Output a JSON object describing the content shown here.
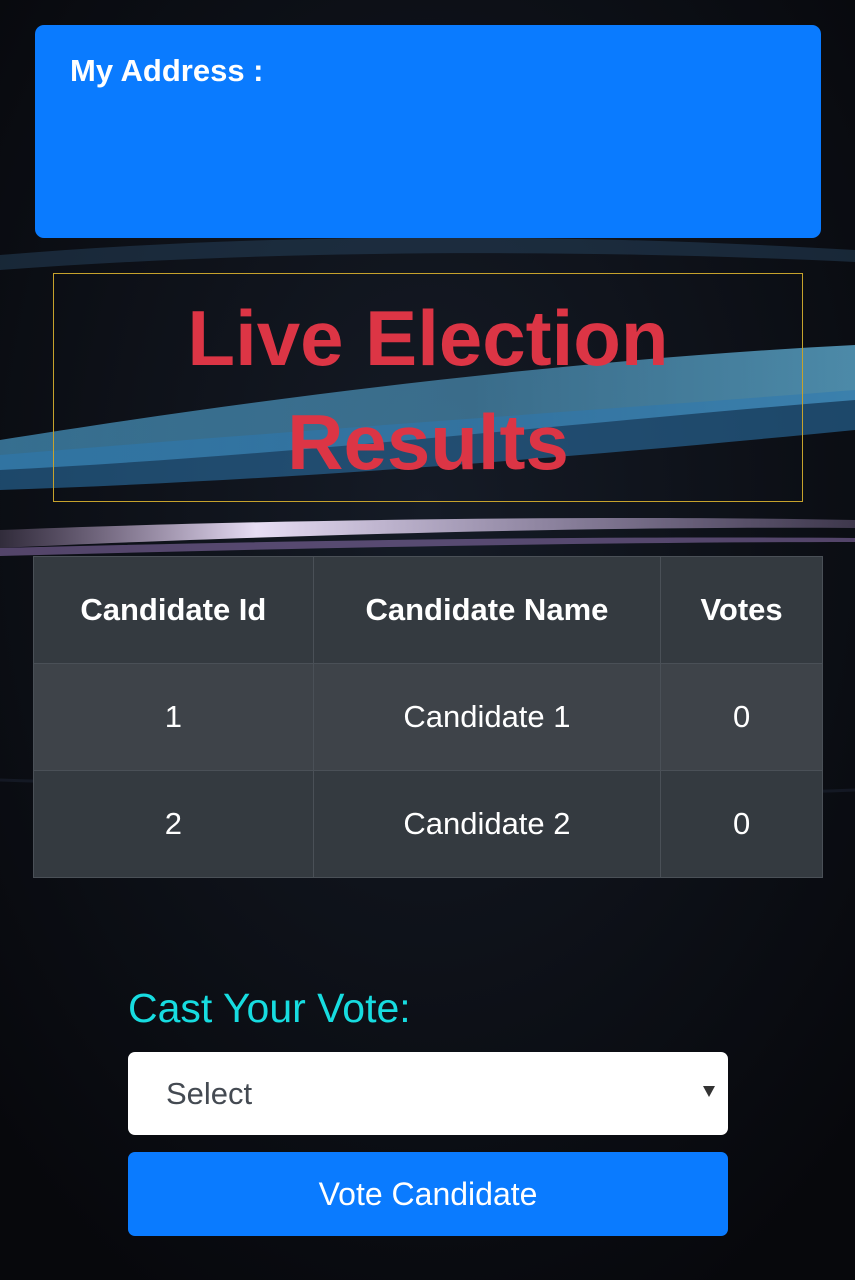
{
  "colors": {
    "accent": "#0a7bff",
    "title": "#dc3545",
    "heading": "#17dce0",
    "title_border": "#c6a22c",
    "table_dark": "#343a40"
  },
  "address": {
    "label": "My Address :"
  },
  "title": "Live Election Results",
  "table": {
    "headers": [
      "Candidate Id",
      "Candidate Name",
      "Votes"
    ],
    "rows": [
      [
        "1",
        "Candidate 1",
        "0"
      ],
      [
        "2",
        "Candidate 2",
        "0"
      ]
    ]
  },
  "vote": {
    "heading": "Cast Your Vote:",
    "select_value": "Select",
    "select_icon": "caret-down-icon",
    "button_label": "Vote Candidate"
  }
}
